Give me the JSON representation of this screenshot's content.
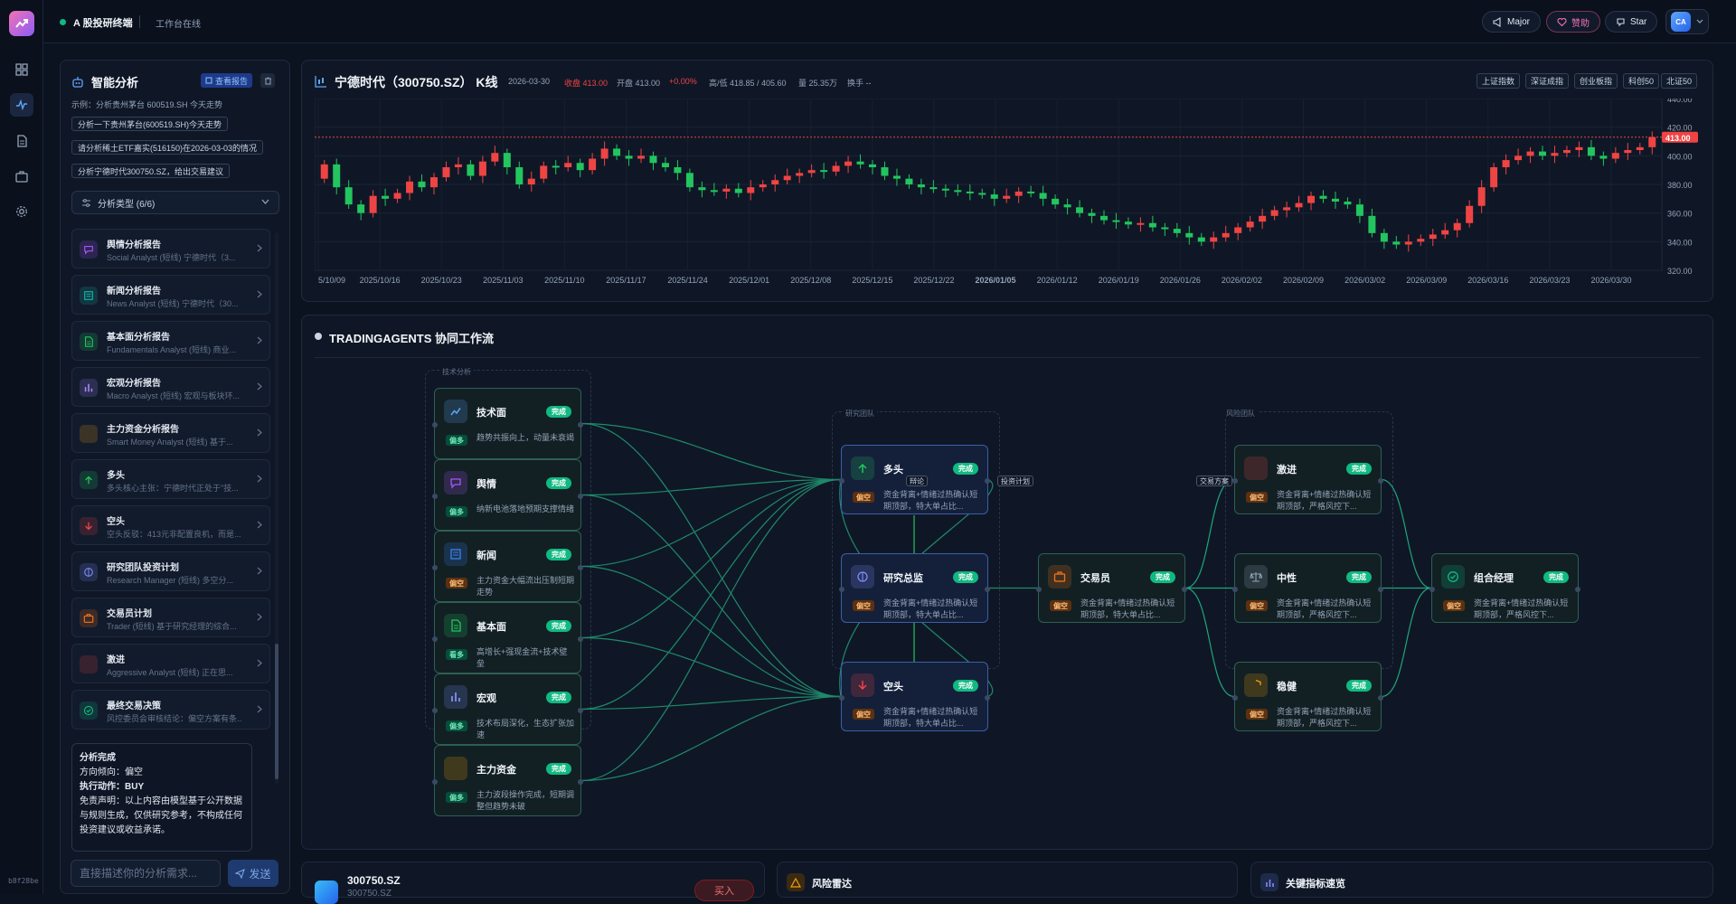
{
  "app": {
    "title": "A 股投研终端",
    "status": "工作台在线",
    "version": "b8f28be"
  },
  "header": {
    "buttons": [
      "Major",
      "赞助",
      "Star"
    ],
    "avatar": "CA"
  },
  "rail": {
    "items": [
      "dashboard-icon",
      "pulse-icon",
      "document-icon",
      "briefcase-icon",
      "gear-icon"
    ]
  },
  "left": {
    "title": "智能分析",
    "report_button": "查看报告",
    "example_label": "示例：分析贵州茅台 600519.SH 今天走势",
    "examples": [
      "分析一下贵州茅台(600519.SH)今天走势",
      "请分析稀土ETF嘉实(516150)在2026-03-03的情况",
      "分析宁德时代300750.SZ，给出交易建议"
    ],
    "filter_label": "分析类型 (6/6)",
    "reports": [
      {
        "name": "舆情分析报告",
        "sub": "Social Analyst (短线) 宁德时代（3...",
        "icon": "chat-icon",
        "color": "#a855f7"
      },
      {
        "name": "新闻分析报告",
        "sub": "News Analyst (短线) 宁德时代（30...",
        "icon": "news-icon",
        "color": "#14b8a6"
      },
      {
        "name": "基本面分析报告",
        "sub": "Fundamentals Analyst (短线) 商业...",
        "icon": "file-icon",
        "color": "#22c55e"
      },
      {
        "name": "宏观分析报告",
        "sub": "Macro Analyst (短线) 宏观与板块环...",
        "icon": "bar-chart-icon",
        "color": "#a78bfa"
      },
      {
        "name": "主力资金分析报告",
        "sub": "Smart Money Analyst (短线) 基于...",
        "icon": "dollar-icon",
        "color": "#f59e0b"
      },
      {
        "name": "多头",
        "sub": "多头核心主张：宁德时代正处于\"技...",
        "icon": "arrow-up-icon",
        "color": "#22c55e"
      },
      {
        "name": "空头",
        "sub": "空头反驳：413元非配置良机，而是...",
        "icon": "arrow-down-icon",
        "color": "#ef4444"
      },
      {
        "name": "研究团队投资计划",
        "sub": "Research Manager (短线) 多空分...",
        "icon": "brain-icon",
        "color": "#818cf8"
      },
      {
        "name": "交易员计划",
        "sub": "Trader (短线) 基于研究经理的综合...",
        "icon": "briefcase-icon",
        "color": "#f97316"
      },
      {
        "name": "激进",
        "sub": "Aggressive Analyst (短线) 正在思...",
        "icon": "flame-icon",
        "color": "#ef4444"
      },
      {
        "name": "最终交易决策",
        "sub": "风控委员会审核结论：偏空方案有条...",
        "icon": "check-circle-icon",
        "color": "#10b981"
      }
    ],
    "summary": {
      "title": "分析完成",
      "direction": "方向倾向：偏空",
      "action": "执行动作：BUY",
      "disclaimer": "免责声明：以上内容由模型基于公开数据与规则生成，仅供研究参考，不构成任何投资建议或收益承诺。"
    },
    "input_placeholder": "直接描述你的分析需求...",
    "send_label": "发送"
  },
  "chart": {
    "title": "宁德时代（300750.SZ） K线",
    "date": "2026-03-30",
    "close": "收盘 413.00",
    "open": "开盘 413.00",
    "change": "+0.00%",
    "hilo": "高/低 418.85 / 405.60",
    "volume": "量 25.35万",
    "turnover": "换手 --",
    "indices": [
      "上证指数",
      "深证成指",
      "创业板指",
      "科创50",
      "北证50"
    ],
    "last_label": "413.00",
    "colors": {
      "up": "#ef4444",
      "down": "#22c55e"
    },
    "chart_data": {
      "type": "candlestick",
      "x_ticks": [
        "5/10/09",
        "2025/10/16",
        "2025/10/23",
        "2025/11/03",
        "2025/11/10",
        "2025/11/17",
        "2025/11/24",
        "2025/12/01",
        "2025/12/08",
        "2025/12/15",
        "2025/12/22",
        "2026/01/05",
        "2026/01/12",
        "2026/01/19",
        "2026/01/26",
        "2026/02/02",
        "2026/02/09",
        "2026/03/02",
        "2026/03/09",
        "2026/03/16",
        "2026/03/23",
        "2026/03/30"
      ],
      "y_ticks": [
        "440.00",
        "420.00",
        "400.00",
        "380.00",
        "360.00",
        "340.00",
        "320.00"
      ],
      "ylim": [
        320,
        440
      ],
      "last_close": 413,
      "closes": [
        394,
        378,
        366,
        360,
        372,
        370,
        374,
        382,
        378,
        385,
        392,
        394,
        386,
        396,
        402,
        392,
        380,
        384,
        393,
        392,
        395,
        390,
        398,
        405,
        400,
        398,
        400,
        395,
        392,
        388,
        378,
        376,
        375,
        377,
        374,
        378,
        380,
        383,
        386,
        388,
        390,
        389,
        393,
        396,
        394,
        392,
        386,
        384,
        380,
        378,
        377,
        376,
        375,
        374,
        373,
        370,
        372,
        375,
        374,
        370,
        366,
        364,
        360,
        358,
        355,
        354,
        352,
        353,
        350,
        349,
        346,
        343,
        340,
        343,
        346,
        350,
        354,
        358,
        362,
        364,
        367,
        372,
        370,
        368,
        366,
        358,
        346,
        340,
        338,
        340,
        342,
        345,
        348,
        353,
        365,
        378,
        392,
        397,
        400,
        403,
        400,
        402,
        404,
        406,
        400,
        398,
        402,
        404,
        406,
        413
      ]
    }
  },
  "workflow": {
    "title": "TRADINGAGENTS 协同工作流",
    "groups": {
      "tech": "技术分析",
      "research": "研究团队",
      "risk": "风险团队"
    },
    "status": "完成",
    "nodes": [
      {
        "id": "tech",
        "name": "技术面",
        "tag": "偏多",
        "desc": "趋势共振向上，动量未衰竭",
        "icon": "trend-icon",
        "color": "#60a5fa"
      },
      {
        "id": "senti",
        "name": "舆情",
        "tag": "偏多",
        "desc": "纳新电池落地预期支撑情绪",
        "icon": "chat-icon",
        "color": "#a855f7"
      },
      {
        "id": "news",
        "name": "新闻",
        "tag": "偏空",
        "desc": "主力资金大幅流出压制短期走势",
        "icon": "news-icon",
        "color": "#3b82f6"
      },
      {
        "id": "fund",
        "name": "基本面",
        "tag": "看多",
        "desc": "高增长+强现金流+技术壁垒",
        "icon": "file-icon",
        "color": "#22c55e"
      },
      {
        "id": "macro",
        "name": "宏观",
        "tag": "偏多",
        "desc": "技术布局深化，生态扩张加速",
        "icon": "bar-chart-icon",
        "color": "#818cf8"
      },
      {
        "id": "money",
        "name": "主力资金",
        "tag": "偏多",
        "desc": "主力波段操作完成，短期调整但趋势未破",
        "icon": "dollar-icon",
        "color": "#f59e0b"
      },
      {
        "id": "bull",
        "name": "多头",
        "tag": "偏空",
        "desc": "资金背离+情绪过热确认短期顶部，特大单占比...",
        "icon": "arrow-up-icon",
        "color": "#22c55e"
      },
      {
        "id": "mgr",
        "name": "研究总监",
        "tag": "偏空",
        "desc": "资金背离+情绪过热确认短期顶部，特大单占比...",
        "icon": "brain-icon",
        "color": "#818cf8"
      },
      {
        "id": "bear",
        "name": "空头",
        "tag": "偏空",
        "desc": "资金背离+情绪过热确认短期顶部，特大单占比...",
        "icon": "arrow-down-icon",
        "color": "#ef4444"
      },
      {
        "id": "trader",
        "name": "交易员",
        "tag": "偏空",
        "desc": "资金背离+情绪过热确认短期顶部，特大单占比...",
        "icon": "briefcase-icon",
        "color": "#f97316"
      },
      {
        "id": "aggr",
        "name": "激进",
        "tag": "偏空",
        "desc": "资金背离+情绪过热确认短期顶部，严格风控下...",
        "icon": "flame-icon",
        "color": "#ef4444"
      },
      {
        "id": "neut",
        "name": "中性",
        "tag": "偏空",
        "desc": "资金背离+情绪过热确认短期顶部，严格风控下...",
        "icon": "scale-icon",
        "color": "#94a3b8"
      },
      {
        "id": "cons",
        "name": "稳健",
        "tag": "偏空",
        "desc": "资金背离+情绪过热确认短期顶部，严格风控下...",
        "icon": "shield-icon",
        "color": "#f59e0b"
      },
      {
        "id": "pm",
        "name": "组合经理",
        "tag": "偏空",
        "desc": "资金背离+情绪过热确认短期顶部，严格风控下...",
        "icon": "check-circle-icon",
        "color": "#10b981"
      }
    ],
    "edge_labels": {
      "debate": "辩论",
      "plan": "投资计划",
      "proposal": "交易方案"
    }
  },
  "bottom": {
    "symbol": "300750.SZ",
    "symbol_sub": "300750.SZ",
    "action": "买入",
    "risk": "风险雷达",
    "metrics": "关键指标速览"
  }
}
